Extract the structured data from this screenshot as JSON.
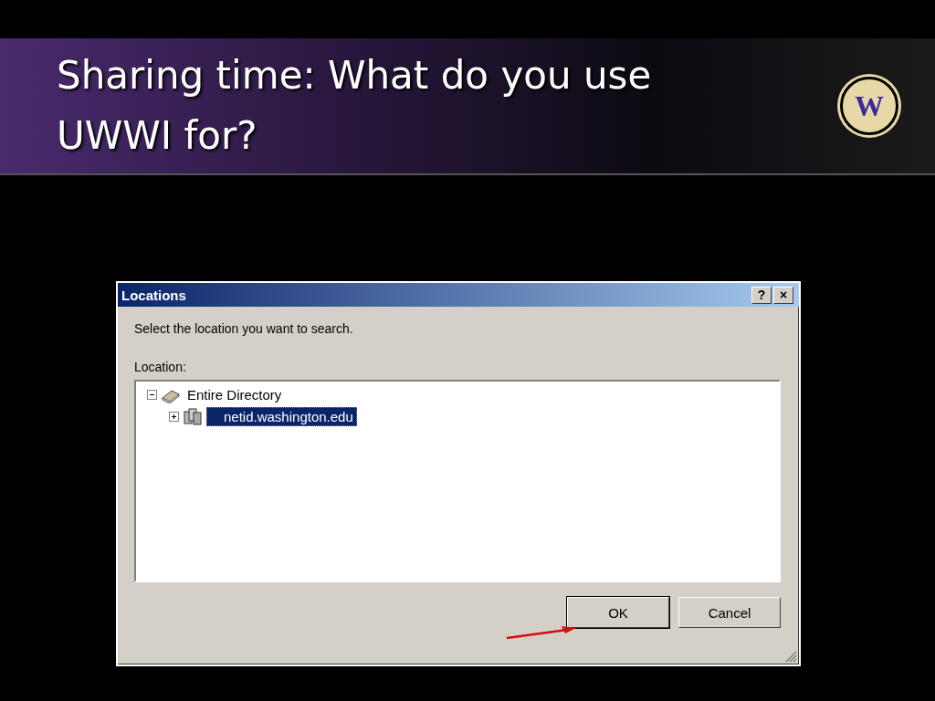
{
  "slide": {
    "title": "Sharing time: What do you use UWWI for?",
    "logo": {
      "letter": "W"
    }
  },
  "dialog": {
    "title": "Locations",
    "title_buttons": [
      "?",
      "×"
    ],
    "prompt": "Select the location you want to search.",
    "field_label": "Location:",
    "tree": [
      {
        "label": "Entire Directory",
        "expanded": true,
        "selected": false,
        "children": [
          {
            "label": "netid.washington.edu",
            "expanded": false,
            "selected": true
          }
        ]
      }
    ],
    "buttons": [
      {
        "label": "OK",
        "default": true
      },
      {
        "label": "Cancel",
        "default": false
      }
    ]
  }
}
